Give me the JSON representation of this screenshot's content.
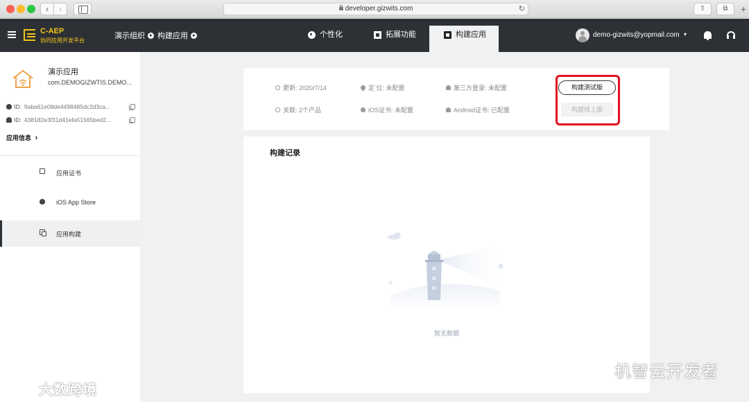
{
  "browser": {
    "url": "developer.gizwits.com",
    "back_glyph": "‹",
    "forward_glyph": "›",
    "reload_glyph": "↻",
    "share_glyph": "⇧",
    "tabs_glyph": "⧉",
    "plus_glyph": "+"
  },
  "header": {
    "logo_title": "C-AEP",
    "logo_subtitle": "协同应用开发平台",
    "breadcrumb": [
      "演示组织",
      "构建应用"
    ],
    "tabs": [
      {
        "label": "个性化",
        "icon": "palette-icon"
      },
      {
        "label": "拓展功能",
        "icon": "extend-icon"
      },
      {
        "label": "构建应用",
        "icon": "build-icon",
        "active": true
      }
    ],
    "user_email": "demo-gizwits@yopmail.com",
    "user_caret": "▾",
    "accent_color": "#f5c518",
    "bg_color": "#2d3035"
  },
  "sidebar": {
    "app_name": "演示应用",
    "app_package": "com.DEMOGIZWTIS.DEMO...",
    "ios_id_label": "ID:",
    "ios_id": "9aba61e08de4498485dc2d3ca...",
    "android_id_label": "ID:",
    "android_id": "438182e3f31d41efa51565bed2...",
    "app_info": "应用信息",
    "app_info_chevron": "›",
    "items": [
      {
        "label": "应用证书",
        "icon": "certificate-icon"
      },
      {
        "label": "iOS App Store",
        "icon": "apple-icon"
      },
      {
        "label": "应用构建",
        "icon": "build-icon",
        "active": true
      }
    ]
  },
  "info": {
    "updated": "更新: 2020/7/14",
    "location": "定 位: 未配置",
    "third_login": "第三方登录: 未配置",
    "linked": "关联: 2个产品",
    "ios_cert": "iOS证书: 未配置",
    "android_cert": "Android证书: 已配置",
    "btn_test": "构建测试版",
    "btn_release": "构建线上版",
    "highlight_color": "#e0101e"
  },
  "records": {
    "title": "构建记录",
    "empty_text": "暂无数据"
  },
  "watermarks": {
    "left": "大数跨境",
    "right": "机智云开发者"
  }
}
